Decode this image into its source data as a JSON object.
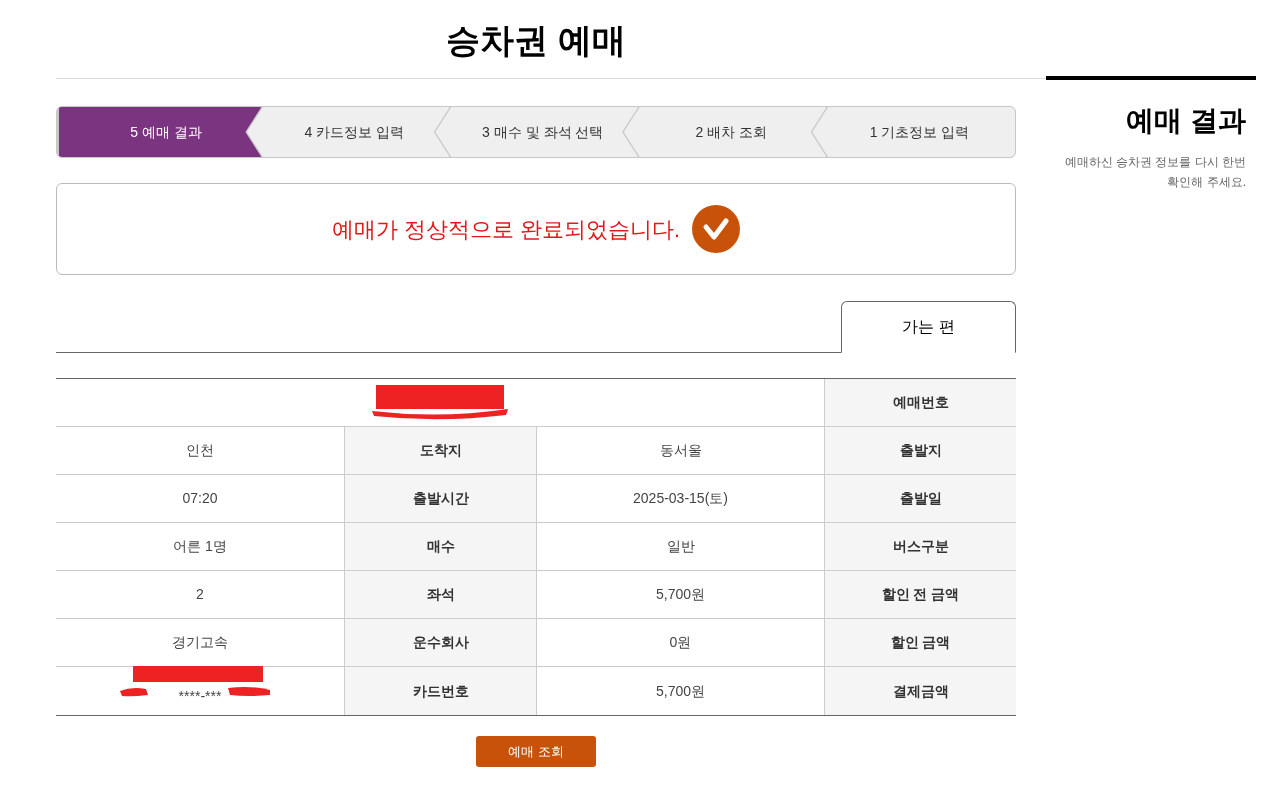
{
  "title": "승차권 예매",
  "sidebar": {
    "heading": "예매 결과",
    "description": "예매하신 승차권 정보를 다시 한번 확인해 주세요."
  },
  "steps": [
    {
      "number": "5",
      "label": "예매 결과",
      "selected": true
    },
    {
      "number": "4",
      "label": "카드정보 입력",
      "selected": false
    },
    {
      "number": "3",
      "label": "매수 및 좌석 선택",
      "selected": false
    },
    {
      "number": "2",
      "label": "배차 조회",
      "selected": false
    },
    {
      "number": "1",
      "label": "기초정보 입력",
      "selected": false
    }
  ],
  "message": {
    "text": "예매가 정상적으로 완료되었습니다."
  },
  "tabs": [
    {
      "label": "가는 편",
      "selected": true
    }
  ],
  "reservation": {
    "redacted": true,
    "label": "예매번호"
  },
  "table": {
    "rows": [
      {
        "cells": [
          {
            "kind": "value",
            "text": "인천"
          },
          {
            "kind": "label",
            "text": "도착지"
          },
          {
            "kind": "value",
            "text": "동서울"
          },
          {
            "kind": "label",
            "text": "출발지"
          }
        ]
      },
      {
        "cells": [
          {
            "kind": "value",
            "text": "07:20"
          },
          {
            "kind": "label",
            "text": "출발시간"
          },
          {
            "kind": "value",
            "text": "2025-03-15(토)"
          },
          {
            "kind": "label",
            "text": "출발일"
          }
        ]
      },
      {
        "cells": [
          {
            "kind": "value",
            "text": "어른 1명"
          },
          {
            "kind": "label",
            "text": "매수"
          },
          {
            "kind": "value",
            "text": "일반"
          },
          {
            "kind": "label",
            "text": "버스구분"
          }
        ]
      },
      {
        "cells": [
          {
            "kind": "value",
            "text": "2"
          },
          {
            "kind": "label",
            "text": "좌석"
          },
          {
            "kind": "value",
            "text": "5,700원"
          },
          {
            "kind": "label",
            "text": "할인 전 금액"
          }
        ]
      },
      {
        "cells": [
          {
            "kind": "value",
            "text": "경기고속"
          },
          {
            "kind": "label",
            "text": "운수회사"
          },
          {
            "kind": "value",
            "text": "0원"
          },
          {
            "kind": "label",
            "text": "할인 금액"
          }
        ]
      },
      {
        "cells": [
          {
            "kind": "value",
            "text": "****-***",
            "redacted": true
          },
          {
            "kind": "label",
            "text": "카드번호"
          },
          {
            "kind": "value",
            "text": "5,700원"
          },
          {
            "kind": "label",
            "text": "결제금액"
          }
        ]
      }
    ]
  },
  "button": {
    "label": "예매 조회"
  }
}
